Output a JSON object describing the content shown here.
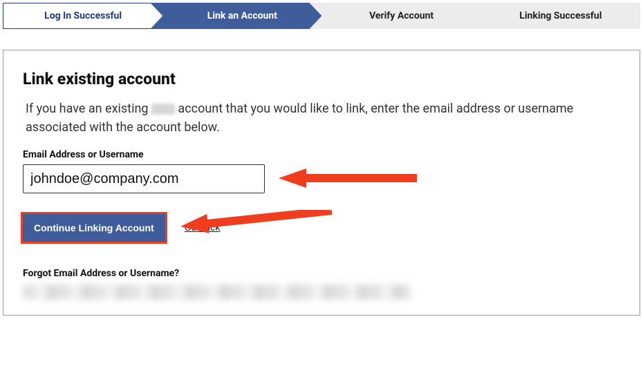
{
  "stepper": {
    "steps": [
      {
        "label": "Log In Successful",
        "state": "completed"
      },
      {
        "label": "Link an Account",
        "state": "active"
      },
      {
        "label": "Verify Account",
        "state": "upcoming"
      },
      {
        "label": "Linking Successful",
        "state": "upcoming"
      }
    ]
  },
  "main": {
    "title": "Link existing account",
    "intro_prefix": "If you have an existing ",
    "intro_suffix": " account that you would like to link, enter the email address or username associated with the account below.",
    "email_field": {
      "label": "Email Address or Username",
      "value": "johndoe@company.com"
    },
    "continue_button": "Continue Linking Account",
    "go_back": "Go Back",
    "forgot_label": "Forgot Email Address or Username?"
  },
  "colors": {
    "accent": "#3f5d9b",
    "annot": "#ef3d1e"
  }
}
